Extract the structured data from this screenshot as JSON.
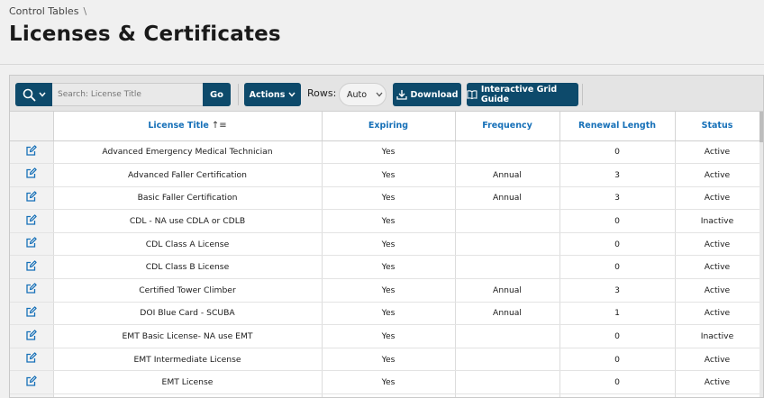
{
  "breadcrumb": {
    "label": "Control Tables",
    "separator": "\\"
  },
  "page_title": "Licenses & Certificates",
  "toolbar": {
    "search_placeholder": "Search: License Title",
    "go_label": "Go",
    "actions_label": "Actions",
    "rows_label": "Rows:",
    "rows_value": "Auto",
    "download_label": "Download",
    "guide_label": "Interactive Grid Guide"
  },
  "colors": {
    "primary": "#0d4a6b",
    "header_text": "#1670b8"
  },
  "grid": {
    "columns": [
      "License Title",
      "Expiring",
      "Frequency",
      "Renewal Length",
      "Status"
    ],
    "sort_indicator": "↑≡",
    "rows": [
      [
        "Advanced Emergency Medical Technician",
        "Yes",
        "",
        "0",
        "Active"
      ],
      [
        "Advanced Faller Certification",
        "Yes",
        "Annual",
        "3",
        "Active"
      ],
      [
        "Basic Faller Certification",
        "Yes",
        "Annual",
        "3",
        "Active"
      ],
      [
        "CDL - NA use CDLA or CDLB",
        "Yes",
        "",
        "0",
        "Inactive"
      ],
      [
        "CDL Class A License",
        "Yes",
        "",
        "0",
        "Active"
      ],
      [
        "CDL Class B License",
        "Yes",
        "",
        "0",
        "Active"
      ],
      [
        "Certified Tower Climber",
        "Yes",
        "Annual",
        "3",
        "Active"
      ],
      [
        "DOI Blue Card - SCUBA",
        "Yes",
        "Annual",
        "1",
        "Active"
      ],
      [
        "EMT Basic License- NA use EMT",
        "Yes",
        "",
        "0",
        "Inactive"
      ],
      [
        "EMT Intermediate License",
        "Yes",
        "",
        "0",
        "Active"
      ],
      [
        "EMT License",
        "Yes",
        "",
        "0",
        "Active"
      ],
      [
        "",
        "",
        "",
        "",
        ""
      ]
    ]
  }
}
